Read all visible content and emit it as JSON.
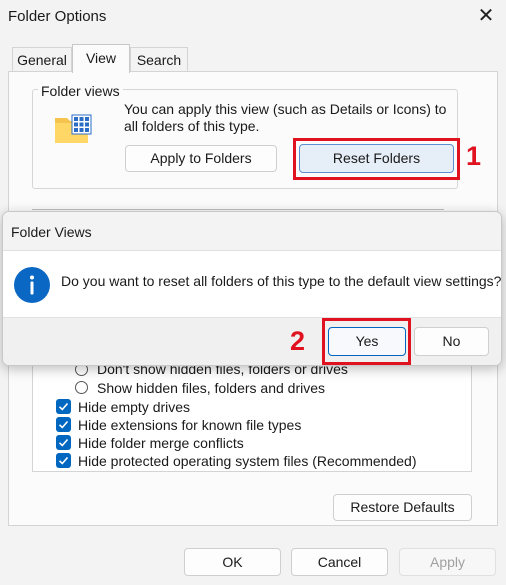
{
  "window": {
    "title": "Folder Options",
    "close_icon": "close-icon"
  },
  "tabs": [
    {
      "label": "General",
      "active": false
    },
    {
      "label": "View",
      "active": true
    },
    {
      "label": "Search",
      "active": false
    }
  ],
  "folder_views": {
    "legend": "Folder views",
    "description": "You can apply this view (such as Details or Icons) to all folders of this type.",
    "apply_button": "Apply to Folders",
    "reset_button": "Reset Folders"
  },
  "annotations": {
    "step1": "1",
    "step2": "2",
    "color": "#e0121f"
  },
  "dialog": {
    "title": "Folder Views",
    "message": "Do you want to reset all folders of this type to the default view settings?",
    "yes_button": "Yes",
    "no_button": "No",
    "icon": "info-icon"
  },
  "advanced_settings": {
    "items": [
      {
        "type": "radio",
        "label": "Don't show hidden files, folders or drives",
        "checked": false
      },
      {
        "type": "radio",
        "label": "Show hidden files, folders and drives",
        "checked": false
      },
      {
        "type": "checkbox",
        "label": "Hide empty drives",
        "checked": true
      },
      {
        "type": "checkbox",
        "label": "Hide extensions for known file types",
        "checked": true
      },
      {
        "type": "checkbox",
        "label": "Hide folder merge conflicts",
        "checked": true
      },
      {
        "type": "checkbox",
        "label": "Hide protected operating system files (Recommended)",
        "checked": true
      }
    ]
  },
  "buttons": {
    "restore_defaults": "Restore Defaults",
    "ok": "OK",
    "cancel": "Cancel",
    "apply": "Apply"
  },
  "colors": {
    "accent": "#0067c0",
    "annotation": "#e0121f"
  }
}
